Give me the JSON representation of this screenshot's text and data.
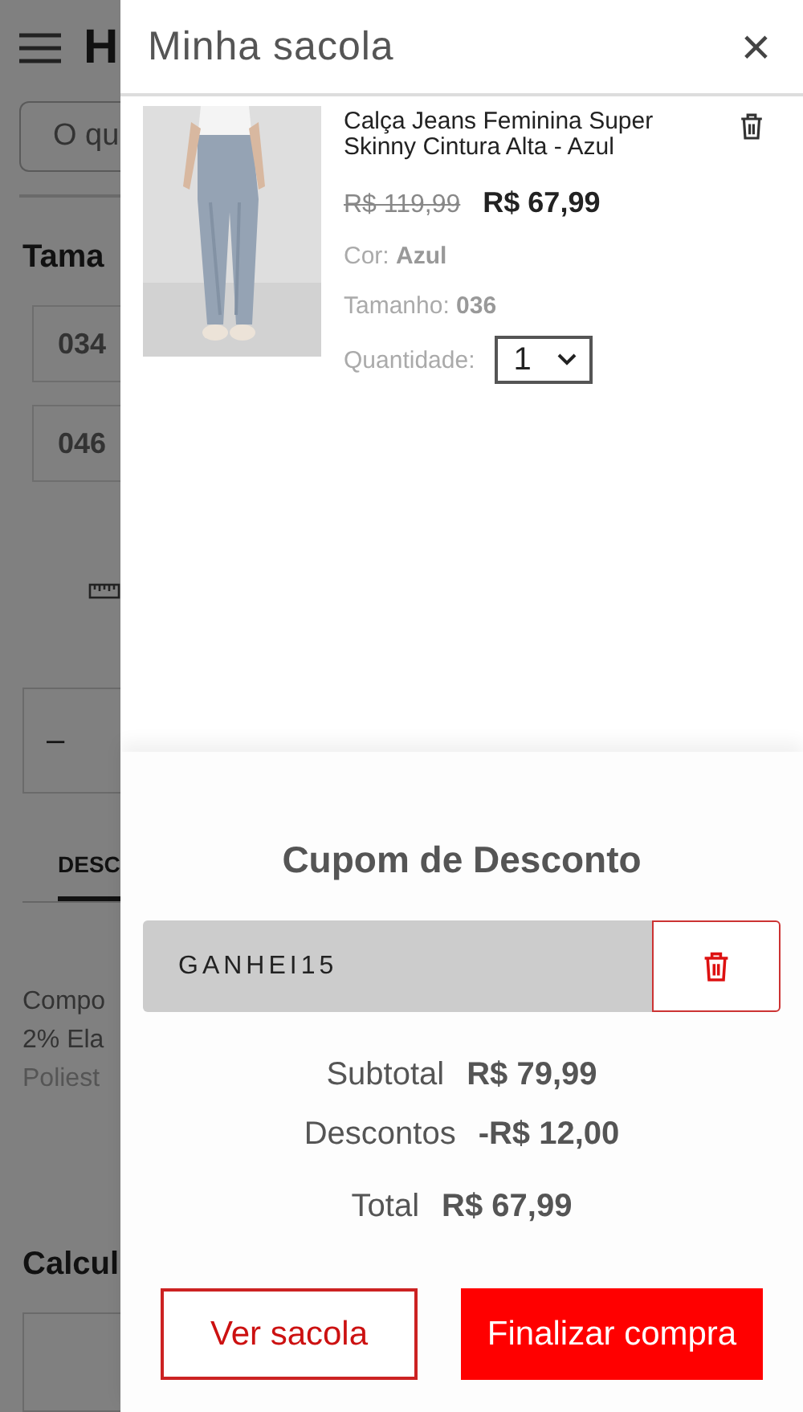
{
  "background_page": {
    "logo": "H",
    "search": {
      "placeholder": "O qu"
    },
    "size_heading": "Tama",
    "sizes": [
      "034",
      "046"
    ],
    "quantity_minus": "–",
    "tabs": [
      {
        "label": "DESC",
        "selected": true
      }
    ],
    "description": [
      {
        "text": "Compo",
        "faded": false
      },
      {
        "text": "2% Ela",
        "faded": false
      },
      {
        "text": "Poliest",
        "faded": true
      }
    ],
    "shipping_heading": "Calcul"
  },
  "drawer": {
    "title": "Minha sacola",
    "close": "×",
    "items": [
      {
        "name": "Calça Jeans Feminina Super Skinny Cintura Alta - Azul",
        "old_price": "R$ 119,99",
        "price": "R$ 67,99",
        "color_label": "Cor:",
        "color_name": "Azul",
        "size_label": "Tamanho:",
        "size": "036",
        "quantity_label": "Quantidade:",
        "quantity": "1"
      }
    ],
    "coupon": {
      "heading": "Cupom de Desconto",
      "code": "GANHEI15"
    },
    "summary": [
      {
        "label": "Subtotal",
        "value": "R$ 79,99"
      },
      {
        "label": "Descontos",
        "value": "-R$ 12,00"
      },
      {
        "label": "Total",
        "value": "R$ 67,99"
      }
    ],
    "buttons": [
      {
        "label": "Ver sacola",
        "kind": "secondary"
      },
      {
        "label": "Finalizar compra",
        "kind": "primary"
      }
    ]
  }
}
